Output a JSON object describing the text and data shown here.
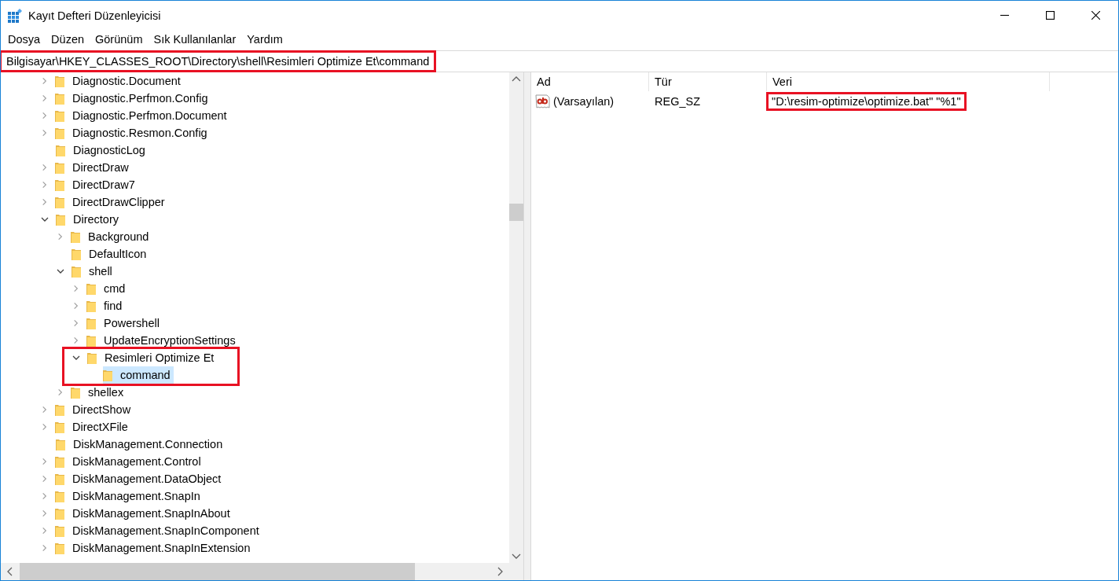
{
  "window": {
    "title": "Kayıt Defteri Düzenleyicisi"
  },
  "menu": [
    "Dosya",
    "Düzen",
    "Görünüm",
    "Sık Kullanılanlar",
    "Yardım"
  ],
  "address": {
    "value": "Bilgisayar\\HKEY_CLASSES_ROOT\\Directory\\shell\\Resimleri Optimize Et\\command",
    "highlighted": true
  },
  "tree": {
    "items": [
      {
        "label": "Diagnostic.Document",
        "kind": "expandable",
        "expanded": false,
        "selected": false,
        "highlighted": false
      },
      {
        "label": "Diagnostic.Perfmon.Config",
        "kind": "expandable",
        "expanded": false,
        "selected": false,
        "highlighted": false
      },
      {
        "label": "Diagnostic.Perfmon.Document",
        "kind": "expandable",
        "expanded": false,
        "selected": false,
        "highlighted": false
      },
      {
        "label": "Diagnostic.Resmon.Config",
        "kind": "expandable",
        "expanded": false,
        "selected": false,
        "highlighted": false
      },
      {
        "label": "DiagnosticLog",
        "kind": "leaf",
        "selected": false,
        "highlighted": false
      },
      {
        "label": "DirectDraw",
        "kind": "expandable",
        "expanded": false,
        "selected": false,
        "highlighted": false
      },
      {
        "label": "DirectDraw7",
        "kind": "expandable",
        "expanded": false,
        "selected": false,
        "highlighted": false
      },
      {
        "label": "DirectDrawClipper",
        "kind": "expandable",
        "expanded": false,
        "selected": false,
        "highlighted": false
      },
      {
        "label": "Directory",
        "kind": "expandable",
        "expanded": true,
        "selected": false,
        "highlighted": false,
        "children": [
          {
            "label": "Background",
            "kind": "expandable",
            "expanded": false,
            "selected": false,
            "highlighted": false
          },
          {
            "label": "DefaultIcon",
            "kind": "leaf",
            "selected": false,
            "highlighted": false
          },
          {
            "label": "shell",
            "kind": "expandable",
            "expanded": true,
            "selected": false,
            "highlighted": false,
            "children": [
              {
                "label": "cmd",
                "kind": "expandable",
                "expanded": false,
                "selected": false,
                "highlighted": false
              },
              {
                "label": "find",
                "kind": "expandable",
                "expanded": false,
                "selected": false,
                "highlighted": false
              },
              {
                "label": "Powershell",
                "kind": "expandable",
                "expanded": false,
                "selected": false,
                "highlighted": false
              },
              {
                "label": "UpdateEncryptionSettings",
                "kind": "expandable",
                "expanded": false,
                "selected": false,
                "highlighted": false
              },
              {
                "label": "Resimleri Optimize Et",
                "kind": "expandable",
                "expanded": true,
                "selected": false,
                "highlighted": true,
                "children": [
                  {
                    "label": "command",
                    "kind": "leaf",
                    "selected": true,
                    "highlighted": false
                  }
                ]
              }
            ]
          },
          {
            "label": "shellex",
            "kind": "expandable",
            "expanded": false,
            "selected": false,
            "highlighted": false
          }
        ]
      },
      {
        "label": "DirectShow",
        "kind": "expandable",
        "expanded": false,
        "selected": false,
        "highlighted": false
      },
      {
        "label": "DirectXFile",
        "kind": "expandable",
        "expanded": false,
        "selected": false,
        "highlighted": false
      },
      {
        "label": "DiskManagement.Connection",
        "kind": "leaf",
        "selected": false,
        "highlighted": false
      },
      {
        "label": "DiskManagement.Control",
        "kind": "expandable",
        "expanded": false,
        "selected": false,
        "highlighted": false
      },
      {
        "label": "DiskManagement.DataObject",
        "kind": "expandable",
        "expanded": false,
        "selected": false,
        "highlighted": false
      },
      {
        "label": "DiskManagement.SnapIn",
        "kind": "expandable",
        "expanded": false,
        "selected": false,
        "highlighted": false
      },
      {
        "label": "DiskManagement.SnapInAbout",
        "kind": "expandable",
        "expanded": false,
        "selected": false,
        "highlighted": false
      },
      {
        "label": "DiskManagement.SnapInComponent",
        "kind": "expandable",
        "expanded": false,
        "selected": false,
        "highlighted": false
      },
      {
        "label": "DiskManagement.SnapInExtension",
        "kind": "expandable",
        "expanded": false,
        "selected": false,
        "highlighted": false
      }
    ]
  },
  "values": {
    "columns": [
      "Ad",
      "Tür",
      "Veri"
    ],
    "rows": [
      {
        "name": "(Varsayılan)",
        "type": "REG_SZ",
        "data": "\"D:\\resim-optimize\\optimize.bat\" \"%1\"",
        "data_highlighted": true
      }
    ]
  }
}
